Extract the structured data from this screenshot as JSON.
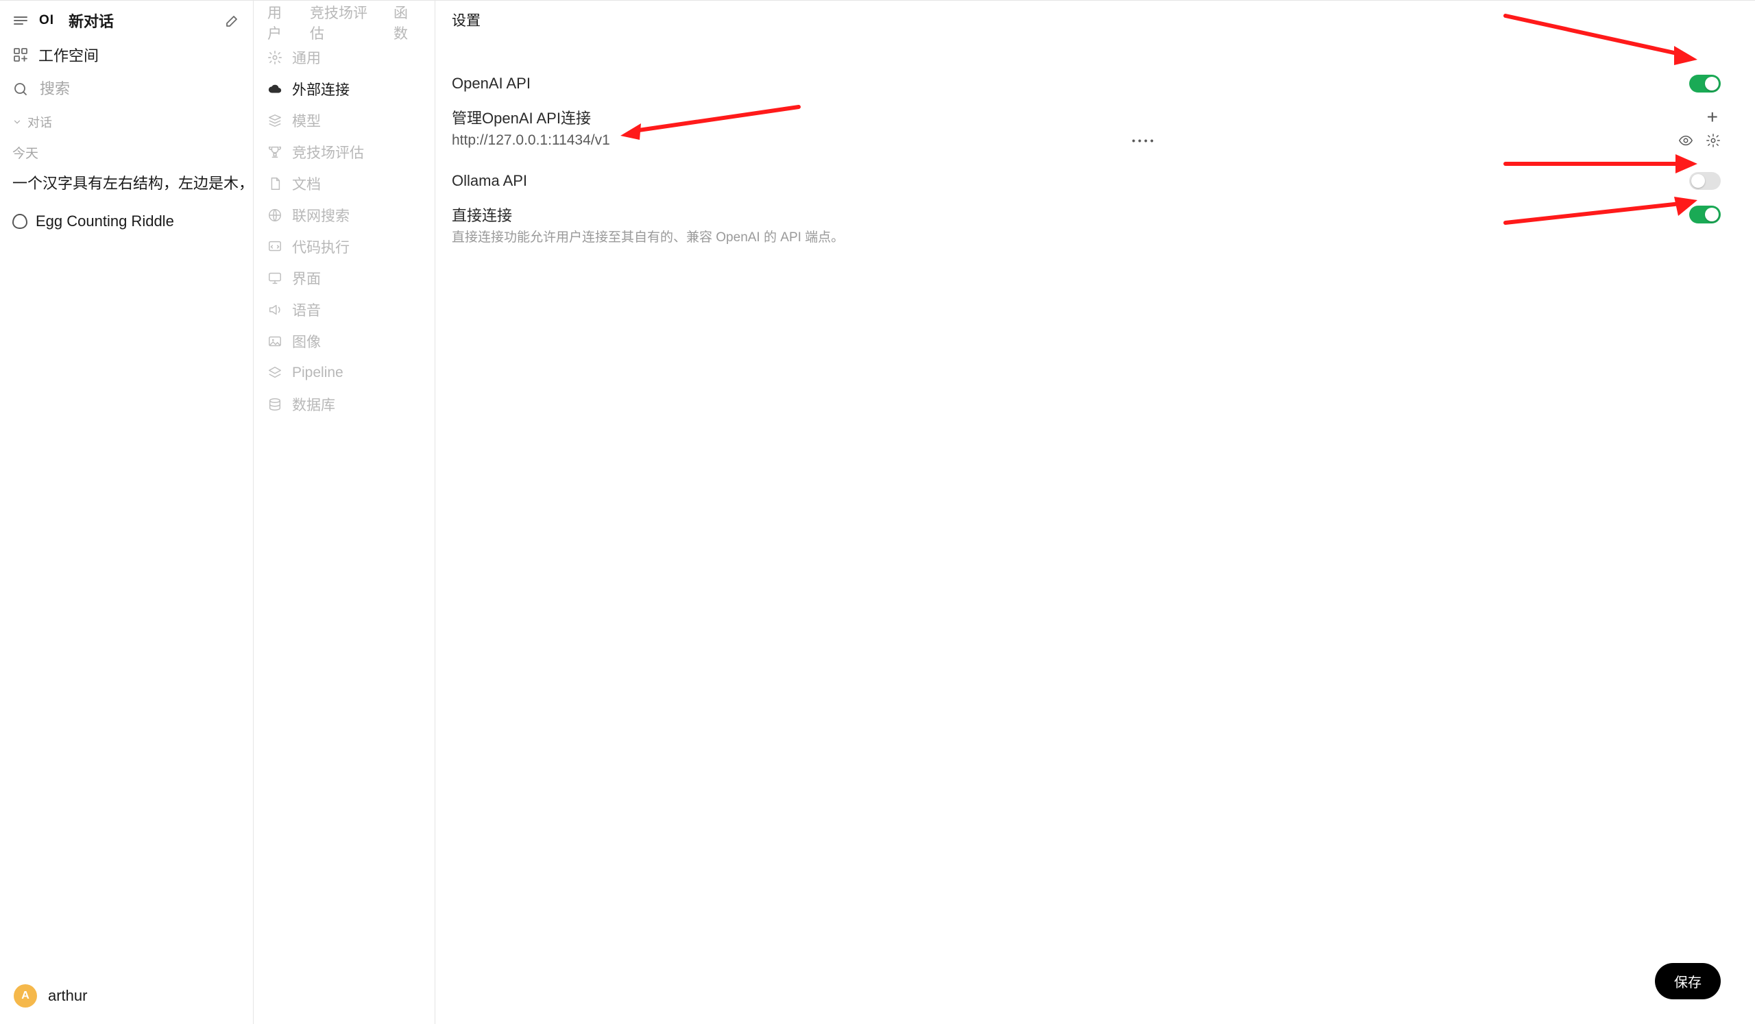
{
  "sidebar": {
    "new_chat_label": "新对话",
    "workspace_label": "工作空间",
    "search_placeholder": "搜索",
    "section_chat": "对话",
    "date_today": "今天",
    "chats": [
      {
        "title": "一个汉字具有左右结构，左边是木，"
      },
      {
        "title": "Egg Counting Riddle"
      }
    ],
    "user": {
      "name": "arthur",
      "initial": "A"
    }
  },
  "tabs": [
    {
      "label": "用户",
      "active": false
    },
    {
      "label": "竞技场评估",
      "active": false
    },
    {
      "label": "函数",
      "active": false
    },
    {
      "label": "设置",
      "active": true
    }
  ],
  "subnav": [
    {
      "icon": "gear",
      "label": "通用"
    },
    {
      "icon": "cloud",
      "label": "外部连接",
      "active": true
    },
    {
      "icon": "stack",
      "label": "模型"
    },
    {
      "icon": "trophy",
      "label": "竞技场评估"
    },
    {
      "icon": "doc",
      "label": "文档"
    },
    {
      "icon": "globe",
      "label": "联网搜索"
    },
    {
      "icon": "code",
      "label": "代码执行"
    },
    {
      "icon": "monitor",
      "label": "界面"
    },
    {
      "icon": "speaker",
      "label": "语音"
    },
    {
      "icon": "image",
      "label": "图像"
    },
    {
      "icon": "layers",
      "label": "Pipeline"
    },
    {
      "icon": "db",
      "label": "数据库"
    }
  ],
  "settings": {
    "openai_api_label": "OpenAI API",
    "openai_api_on": true,
    "openai_api_manage_label": "管理OpenAI API连接",
    "openai_api_conn": {
      "url": "http://127.0.0.1:11434/v1",
      "secret": "••••"
    },
    "ollama_api_label": "Ollama API",
    "ollama_api_on": false,
    "direct_conn_label": "直接连接",
    "direct_conn_desc": "直接连接功能允许用户连接至其自有的、兼容 OpenAI 的 API 端点。",
    "direct_conn_on": true
  },
  "buttons": {
    "save": "保存"
  }
}
